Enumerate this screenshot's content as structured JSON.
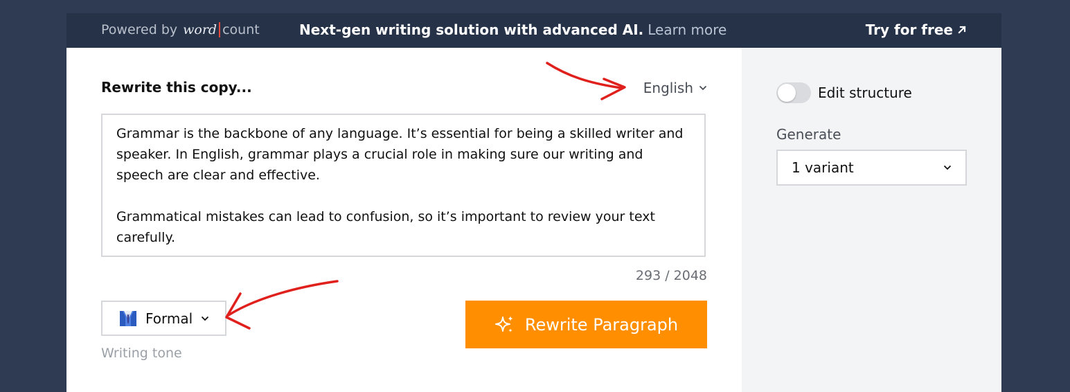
{
  "topbar": {
    "powered_by": "Powered by",
    "brand_word": "word",
    "brand_count": "count",
    "promo_text": "Next-gen writing solution with advanced AI.",
    "promo_link": "Learn more",
    "try_free": "Try for free"
  },
  "editor": {
    "title": "Rewrite this copy...",
    "language": "English",
    "text": "Grammar is the backbone of any language. It’s essential for being a skilled writer and speaker. In English, grammar plays a crucial role in making sure our writing and speech are clear and effective.\n\nGrammatical mistakes can lead to confusion, so it’s important to review your text carefully.",
    "counter": "293 / 2048",
    "tone": {
      "value": "Formal",
      "label": "Writing tone"
    },
    "rewrite_button": "Rewrite Paragraph"
  },
  "sidebar": {
    "edit_structure": "Edit structure",
    "edit_structure_enabled": false,
    "generate_label": "Generate",
    "variant": "1 variant"
  },
  "colors": {
    "accent": "#ff8f00",
    "topbar": "#263248",
    "background": "#2e3b53",
    "annotation": "#e0201c"
  }
}
